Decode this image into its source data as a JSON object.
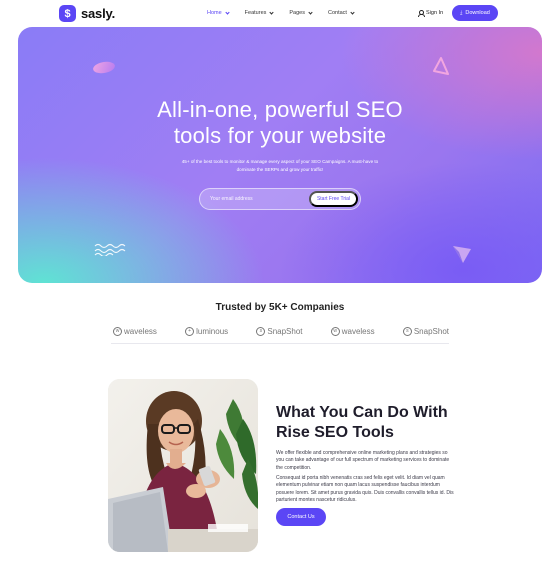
{
  "header": {
    "logo_text": "sasly.",
    "logo_glyph": "$",
    "nav": [
      {
        "label": "Home"
      },
      {
        "label": "Features"
      },
      {
        "label": "Pages"
      },
      {
        "label": "Contact"
      }
    ],
    "signin_label": "Sign In",
    "download_label": "Download"
  },
  "hero": {
    "title_line1": "All-in-one, powerful SEO",
    "title_line2": "tools for your website",
    "subtitle": "45+ of the best tools to monitor & manage every aspect of your SEO Campaigns. A must-have to dominate the SERPs and grow your traffic!",
    "email_placeholder": "Your email address",
    "trial_label": "Start Free Trial"
  },
  "trusted": {
    "title": "Trusted by 5K+ Companies",
    "brands": [
      {
        "name": "waveless",
        "icon": "waveless-logo-icon"
      },
      {
        "name": "luminous",
        "icon": "luminous-logo-icon"
      },
      {
        "name": "SnapShot",
        "icon": "snapshot-logo-icon"
      },
      {
        "name": "waveless",
        "icon": "waveless-logo-icon"
      },
      {
        "name": "SnapShot",
        "icon": "snapshot-logo-icon"
      }
    ]
  },
  "feature": {
    "title_line1": "What You Can Do With",
    "title_line2": "Rise SEO Tools",
    "paragraph1": "We offer flexible and comprehensive online marketing plans and strategies so you can take advantage of our full spectrum of marketing services to dominate the competition.",
    "paragraph2": "Consequat id porta nibh venenatis cras sed felis eget velit. Id diam vel quam elementum pulvinar etiam non quam lacus suspendisse faucibus interdum posuere lorem. Sit amet purus gravida quis. Duis convallis convallis tellus id. Dis parturient montes nascetur ridiculus.",
    "contact_label": "Contact Us"
  },
  "colors": {
    "accent": "#5b46f5",
    "hero_teal": "#5ce8d2",
    "hero_violet": "#8a7cf6",
    "hero_pink": "#dc78c8"
  }
}
